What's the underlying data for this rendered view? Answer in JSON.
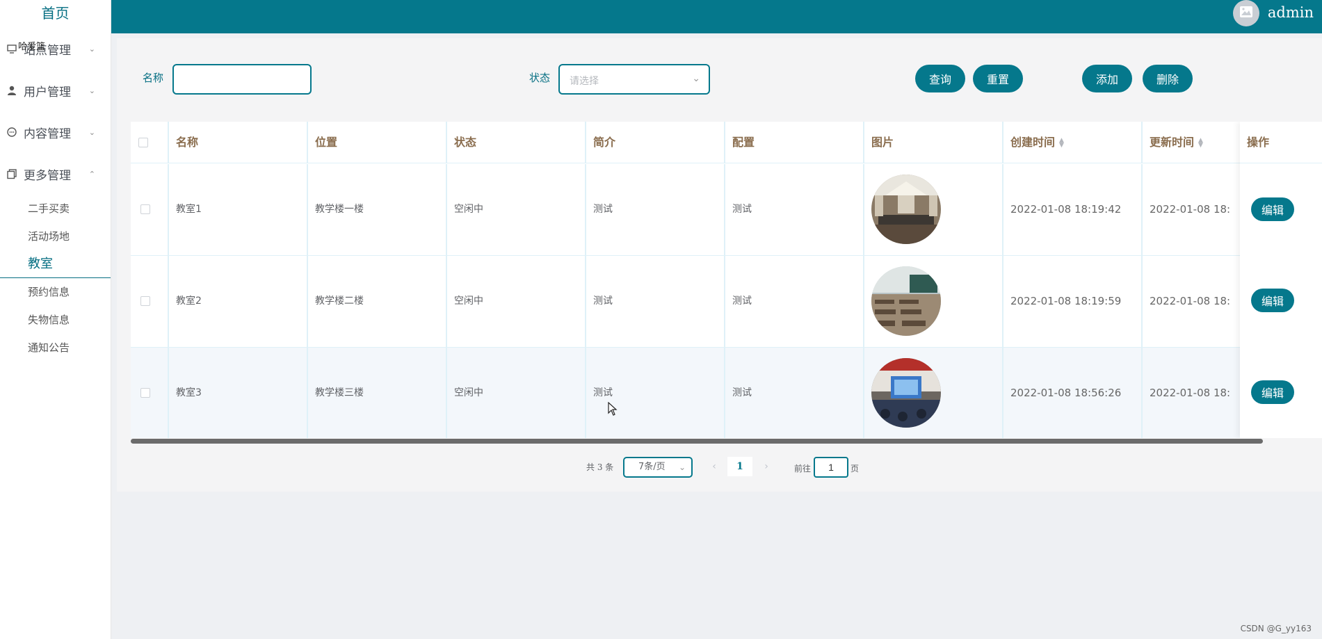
{
  "sidebar": {
    "home": "首页",
    "overlap_text": "哈爱篮",
    "menus": [
      {
        "label": "站点管理",
        "icon": "monitor-icon"
      },
      {
        "label": "用户管理",
        "icon": "user-icon"
      },
      {
        "label": "内容管理",
        "icon": "chat-icon"
      },
      {
        "label": "更多管理",
        "icon": "copy-icon"
      }
    ],
    "submenu": [
      "二手买卖",
      "活动场地",
      "教室",
      "预约信息",
      "失物信息",
      "通知公告"
    ],
    "active_sub": "教室"
  },
  "header": {
    "username": "admin",
    "avatar_icon": "image-icon",
    "color": "#05788c"
  },
  "filters": {
    "name_label": "名称",
    "name_value": "",
    "status_label": "状态",
    "status_placeholder": "请选择"
  },
  "buttons": {
    "query": "查询",
    "reset": "重置",
    "add": "添加",
    "delete": "删除"
  },
  "table": {
    "columns": [
      "名称",
      "位置",
      "状态",
      "简介",
      "配置",
      "图片",
      "创建时间",
      "更新时间",
      "操作"
    ],
    "rows": [
      {
        "name": "教室1",
        "location": "教学楼一楼",
        "status": "空闲中",
        "intro": "测试",
        "config": "测试",
        "image": "classroom-photo-1",
        "created": "2022-01-08 18:19:42",
        "updated": "2022-01-08 18:",
        "action": "编辑"
      },
      {
        "name": "教室2",
        "location": "教学楼二楼",
        "status": "空闲中",
        "intro": "测试",
        "config": "测试",
        "image": "classroom-photo-2",
        "created": "2022-01-08 18:19:59",
        "updated": "2022-01-08 18:",
        "action": "编辑"
      },
      {
        "name": "教室3",
        "location": "教学楼三楼",
        "status": "空闲中",
        "intro": "测试",
        "config": "测试",
        "image": "classroom-photo-3",
        "created": "2022-01-08 18:56:26",
        "updated": "2022-01-08 18:",
        "action": "编辑"
      }
    ]
  },
  "pagination": {
    "total": "共 3 条",
    "page_size": "7条/页",
    "current": "1",
    "goto_prefix": "前往",
    "goto_value": "1",
    "goto_suffix": "页"
  },
  "watermark": "CSDN @G_yy163"
}
